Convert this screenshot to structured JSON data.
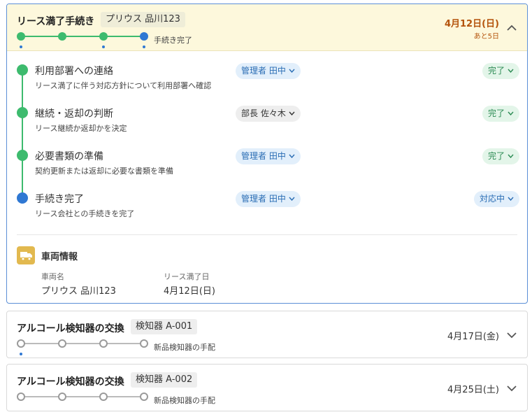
{
  "tasks": [
    {
      "title": "リース満了手続き",
      "tag": "プリウス 品川123",
      "step_label": "手続き完了",
      "date": "4月12日(日)",
      "remaining": "あと5日",
      "stepper_states": [
        "done",
        "done",
        "done",
        "current"
      ],
      "expanded": true
    },
    {
      "title": "アルコール検知器の交換",
      "tag": "検知器 A-001",
      "step_label": "新品検知器の手配",
      "date": "4月17日(金)",
      "stepper_states": [
        "todo",
        "todo",
        "todo",
        "todo"
      ],
      "expanded": false
    },
    {
      "title": "アルコール検知器の交換",
      "tag": "検知器 A-002",
      "step_label": "新品検知器の手配",
      "date": "4月25日(土)",
      "stepper_states": [
        "todo",
        "todo",
        "todo",
        "todo"
      ],
      "expanded": false
    }
  ],
  "steps": [
    {
      "name": "利用部署への連絡",
      "desc": "リース満了に伴う対応方針について利用部署へ確認",
      "assignee": "管理者 田中",
      "status": "完了",
      "state": "done"
    },
    {
      "name": "継続・返却の判断",
      "desc": "リース継続か返却かを決定",
      "assignee": "部長 佐々木",
      "status": "完了",
      "state": "done"
    },
    {
      "name": "必要書類の準備",
      "desc": "契約更新または返却に必要な書類を準備",
      "assignee": "管理者 田中",
      "status": "完了",
      "state": "done"
    },
    {
      "name": "手続き完了",
      "desc": "リース会社との手続きを完了",
      "assignee": "管理者 田中",
      "status": "対応中",
      "state": "current"
    }
  ],
  "vehicle": {
    "heading": "車両情報",
    "name_label": "車両名",
    "name_value": "プリウス 品川123",
    "expiry_label": "リース満了日",
    "expiry_value": "4月12日(日)"
  },
  "colors": {
    "done": "#3dbb6e",
    "current": "#2f78d3",
    "date_accent": "#b4530b",
    "active_header_bg": "#fdf8dc",
    "vehicle_icon_bg": "#e2b94f"
  },
  "icons": {
    "collapse": "chevron-up-icon",
    "expand": "chevron-down-icon",
    "vehicle": "truck-icon",
    "dropdown": "caret-down-icon"
  }
}
